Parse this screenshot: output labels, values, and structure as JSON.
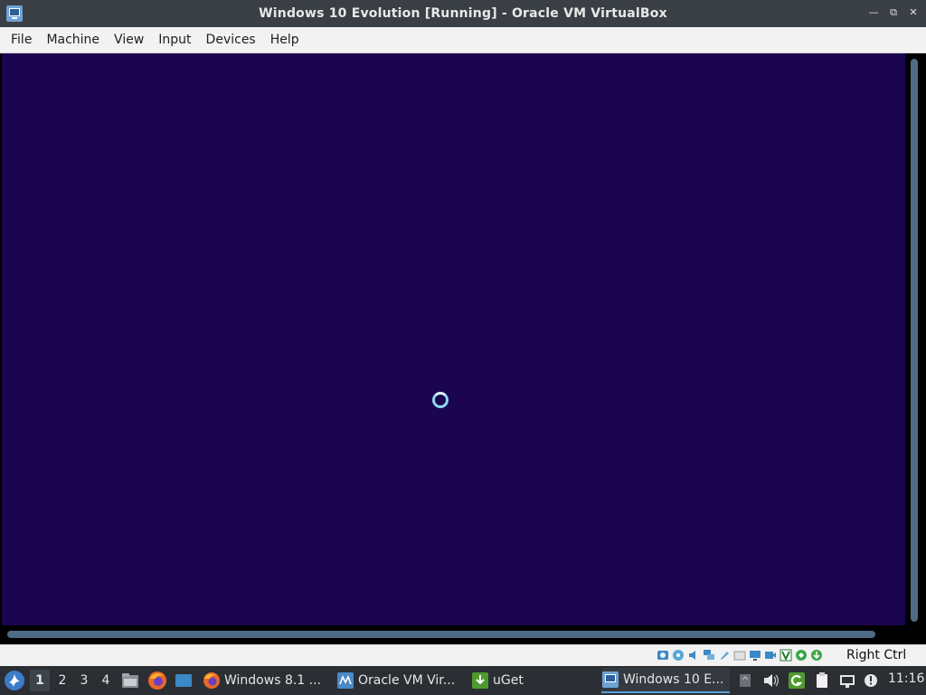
{
  "window": {
    "title": "Windows 10 Evolution [Running] - Oracle VM VirtualBox",
    "controls": [
      "minimize",
      "restore",
      "close"
    ]
  },
  "menubar": {
    "items": [
      "File",
      "Machine",
      "View",
      "Input",
      "Devices",
      "Help"
    ]
  },
  "vm": {
    "screen_color": "#1b0450",
    "state": "loading-spinner"
  },
  "statusbar": {
    "icons": [
      "hard-disk-icon",
      "optical-drive-icon",
      "audio-icon",
      "network-icon",
      "usb-icon",
      "shared-folders-icon",
      "display-icon",
      "video-capture-icon",
      "virtualization-icon",
      "mouse-integration-icon",
      "keyboard-icon"
    ],
    "host_key": "Right Ctrl"
  },
  "taskbar": {
    "workspaces": [
      "1",
      "2",
      "3",
      "4"
    ],
    "active_workspace": "1",
    "tasks": [
      {
        "label": "Windows 8.1 ...",
        "icon": "firefox-icon"
      },
      {
        "label": "Oracle VM Vir...",
        "icon": "virtualbox-manager-icon"
      },
      {
        "label": "uGet",
        "icon": "uget-icon"
      },
      {
        "label": "Windows 10 E...",
        "icon": "virtualbox-vm-icon"
      }
    ],
    "clock": "11:16"
  },
  "colors": {
    "accent": "#5aa0d8",
    "taskbar_bg": "#2b2f34",
    "titlebar_bg": "#3a3f45"
  }
}
